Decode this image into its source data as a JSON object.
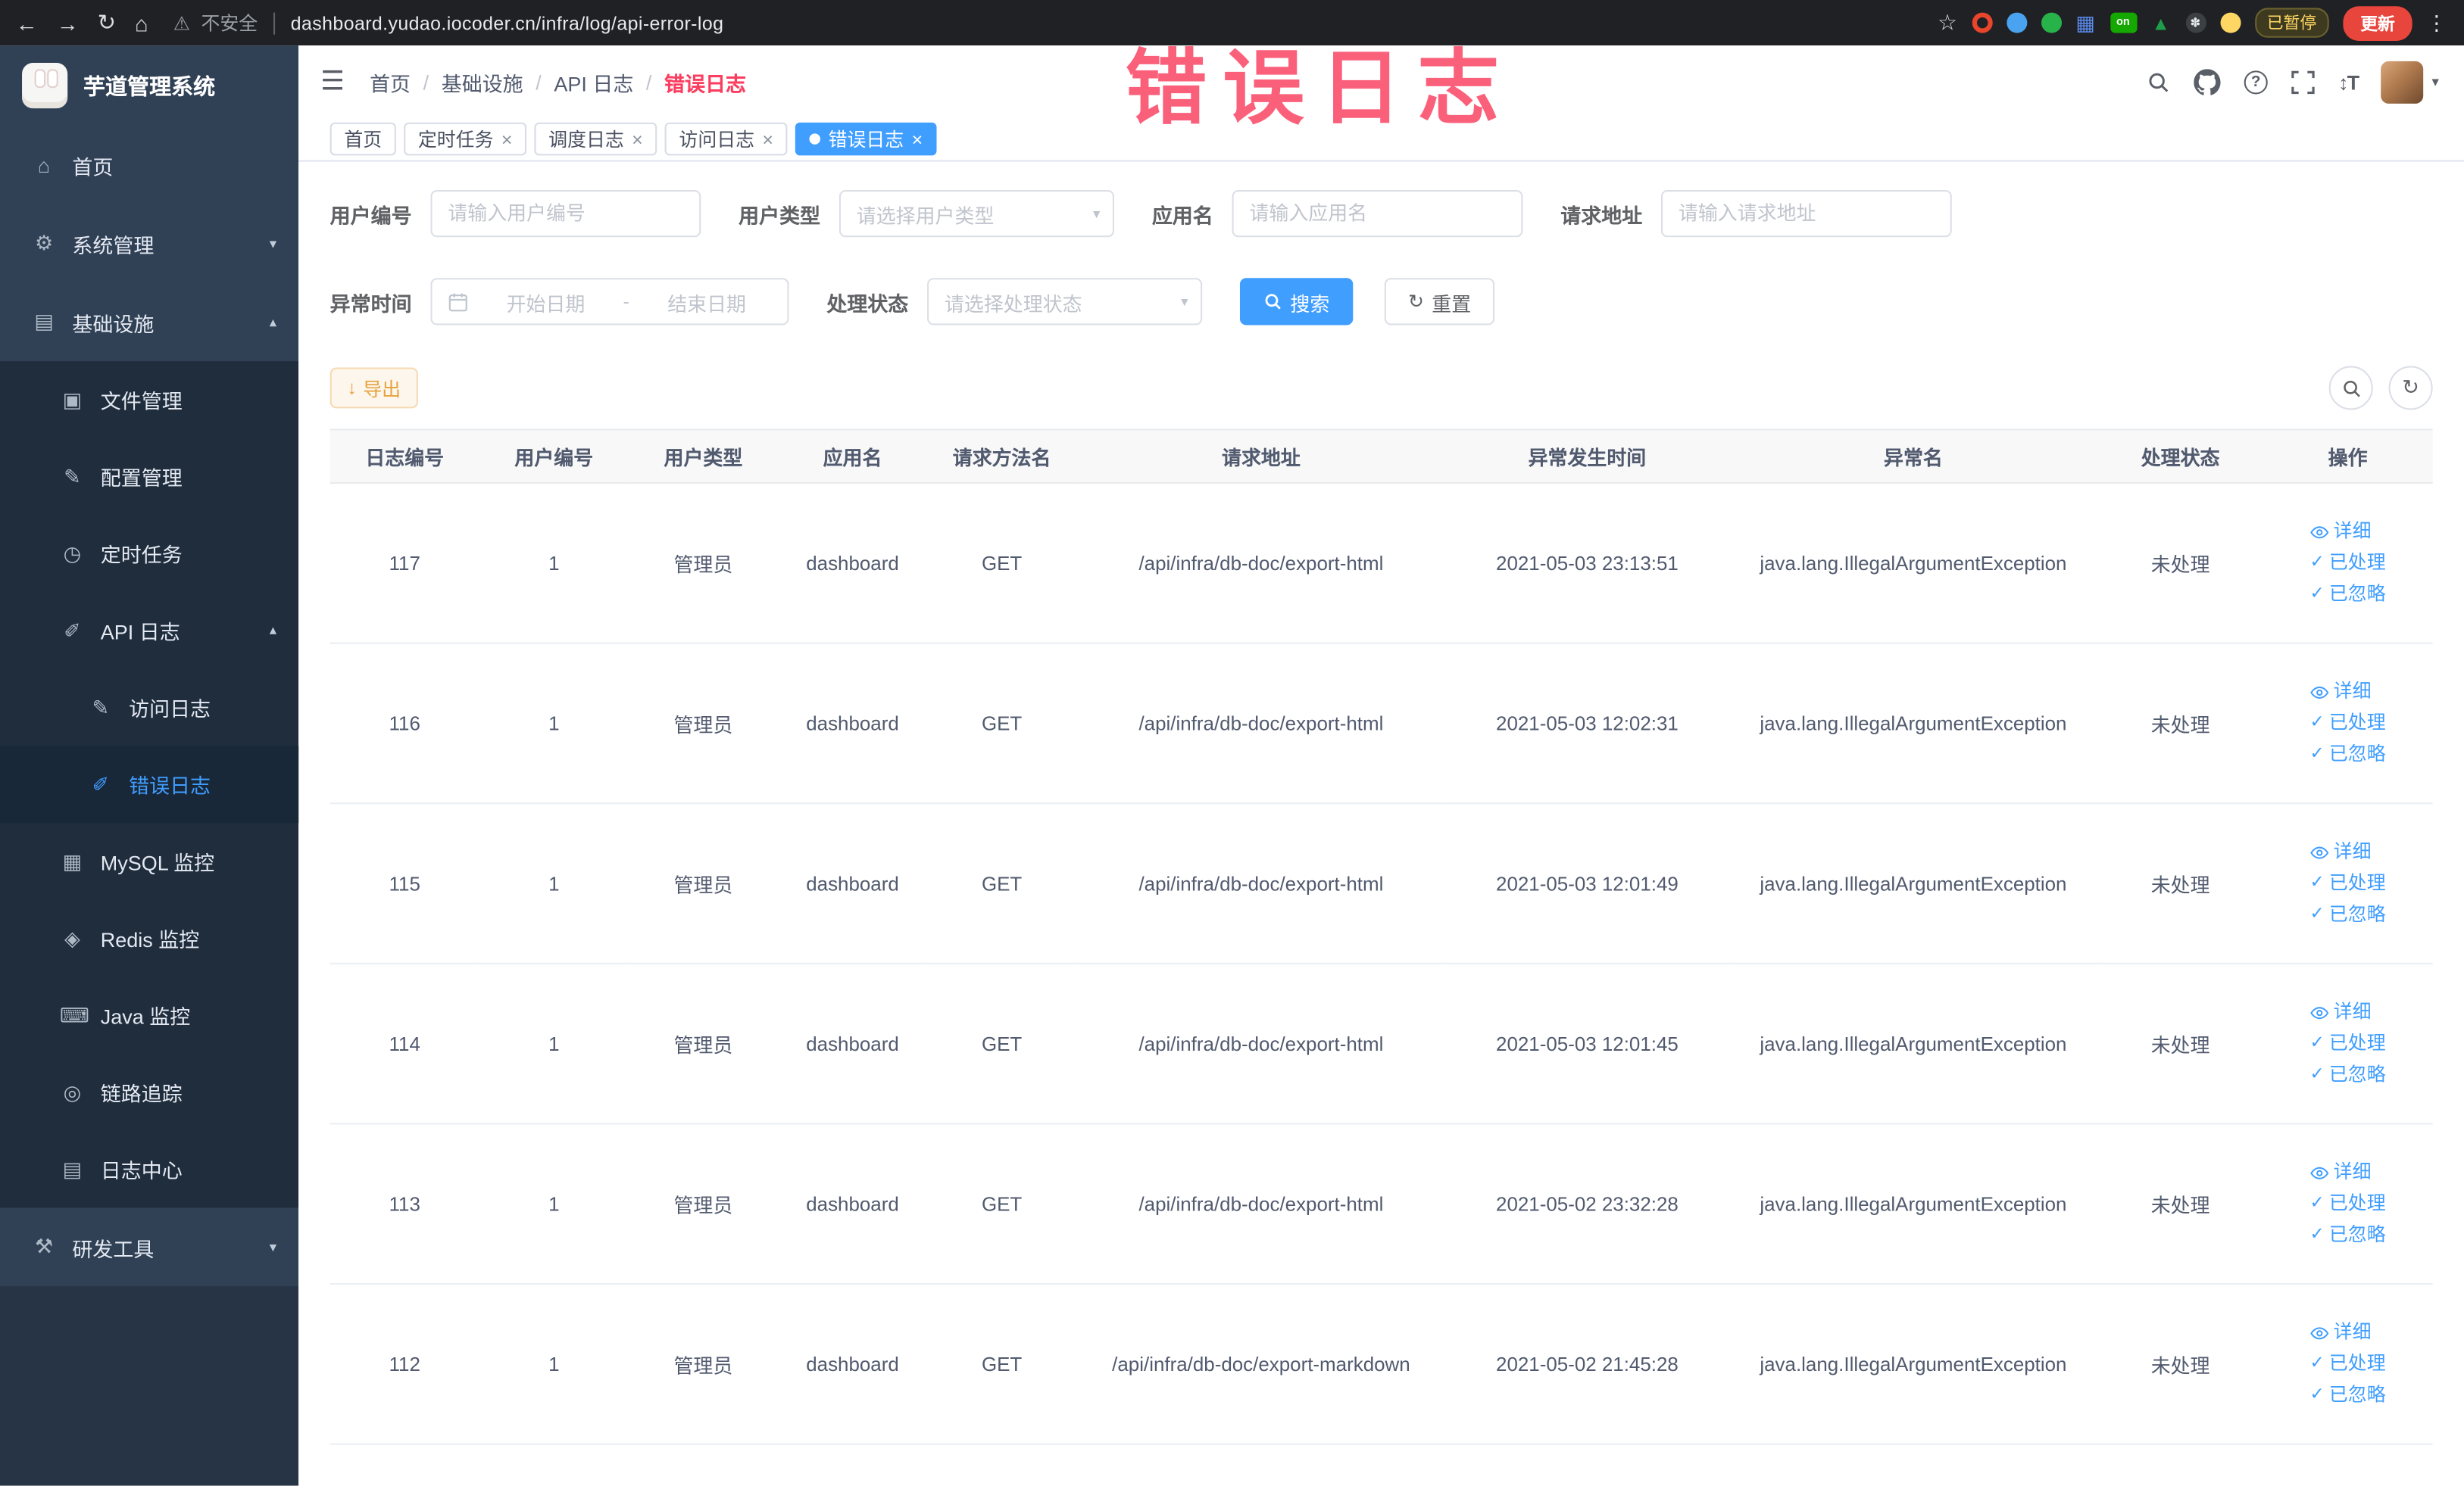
{
  "annotation": {
    "text": "错误日志",
    "color": "#fb3e5f"
  },
  "colors": {
    "accent": "#409EFF",
    "warning": "#e6a23c",
    "sidebar_bg": "#304156",
    "submenu_bg": "#1f2d3d"
  },
  "icons": {
    "back": "←",
    "forward": "→",
    "reload": "↻",
    "home": "⌂",
    "warning": "⚠",
    "star": "☆",
    "more": "⋮",
    "collapse": "☰",
    "slash": "/",
    "chevron_down": "▾",
    "chevron_up": "▴",
    "caret": "▾",
    "close": "×",
    "check": "✓",
    "download": "↓",
    "refresh": "↻",
    "question": "?",
    "text_size": "↕T",
    "grid": "▦",
    "tree": "▲",
    "paw": "✽",
    "on_label": "on"
  },
  "browser": {
    "security_label": "不安全",
    "url": "dashboard.yudao.iocoder.cn/infra/log/api-error-log",
    "paused_badge": "已暂停",
    "update_label": "更新"
  },
  "sidebar": {
    "logo_text": "芋道管理系统",
    "items": [
      {
        "label": "首页",
        "icon": "⌂"
      },
      {
        "label": "系统管理",
        "icon": "⚙"
      },
      {
        "label": "基础设施",
        "icon": "▤"
      },
      {
        "label": "文件管理",
        "icon": "▣"
      },
      {
        "label": "配置管理",
        "icon": "✎"
      },
      {
        "label": "定时任务",
        "icon": "◷"
      },
      {
        "label": "API 日志",
        "icon": "✐"
      },
      {
        "label": "访问日志",
        "icon": "✎"
      },
      {
        "label": "错误日志",
        "icon": "✐"
      },
      {
        "label": "MySQL 监控",
        "icon": "▦"
      },
      {
        "label": "Redis 监控",
        "icon": "◈"
      },
      {
        "label": "Java 监控",
        "icon": "⌨"
      },
      {
        "label": "链路追踪",
        "icon": "◎"
      },
      {
        "label": "日志中心",
        "icon": "▤"
      },
      {
        "label": "研发工具",
        "icon": "⚒"
      }
    ]
  },
  "header": {
    "breadcrumb": [
      "首页",
      "基础设施",
      "API 日志",
      "错误日志"
    ]
  },
  "tabs": [
    {
      "label": "首页"
    },
    {
      "label": "定时任务"
    },
    {
      "label": "调度日志"
    },
    {
      "label": "访问日志"
    },
    {
      "label": "错误日志"
    }
  ],
  "filters": {
    "user_id": {
      "label": "用户编号",
      "placeholder": "请输入用户编号"
    },
    "user_type": {
      "label": "用户类型",
      "placeholder": "请选择用户类型"
    },
    "app_name": {
      "label": "应用名",
      "placeholder": "请输入应用名"
    },
    "request_url": {
      "label": "请求地址",
      "placeholder": "请输入请求地址"
    },
    "exception_time": {
      "label": "异常时间",
      "start_placeholder": "开始日期",
      "separator": "-",
      "end_placeholder": "结束日期"
    },
    "process_status": {
      "label": "处理状态",
      "placeholder": "请选择处理状态"
    },
    "search_label": "搜索",
    "reset_label": "重置"
  },
  "toolbar": {
    "export_label": "导出"
  },
  "table": {
    "headers": [
      "日志编号",
      "用户编号",
      "用户类型",
      "应用名",
      "请求方法名",
      "请求地址",
      "异常发生时间",
      "异常名",
      "处理状态",
      "操作"
    ],
    "actions": {
      "detail": "详细",
      "processed": "已处理",
      "ignored": "已忽略"
    },
    "rows": [
      {
        "id": "117",
        "user_id": "1",
        "user_type": "管理员",
        "app": "dashboard",
        "method": "GET",
        "url": "/api/infra/db-doc/export-html",
        "time": "2021-05-03 23:13:51",
        "exception": "java.lang.IllegalArgumentException",
        "status": "未处理"
      },
      {
        "id": "116",
        "user_id": "1",
        "user_type": "管理员",
        "app": "dashboard",
        "method": "GET",
        "url": "/api/infra/db-doc/export-html",
        "time": "2021-05-03 12:02:31",
        "exception": "java.lang.IllegalArgumentException",
        "status": "未处理"
      },
      {
        "id": "115",
        "user_id": "1",
        "user_type": "管理员",
        "app": "dashboard",
        "method": "GET",
        "url": "/api/infra/db-doc/export-html",
        "time": "2021-05-03 12:01:49",
        "exception": "java.lang.IllegalArgumentException",
        "status": "未处理"
      },
      {
        "id": "114",
        "user_id": "1",
        "user_type": "管理员",
        "app": "dashboard",
        "method": "GET",
        "url": "/api/infra/db-doc/export-html",
        "time": "2021-05-03 12:01:45",
        "exception": "java.lang.IllegalArgumentException",
        "status": "未处理"
      },
      {
        "id": "113",
        "user_id": "1",
        "user_type": "管理员",
        "app": "dashboard",
        "method": "GET",
        "url": "/api/infra/db-doc/export-html",
        "time": "2021-05-02 23:32:28",
        "exception": "java.lang.IllegalArgumentException",
        "status": "未处理"
      },
      {
        "id": "112",
        "user_id": "1",
        "user_type": "管理员",
        "app": "dashboard",
        "method": "GET",
        "url": "/api/infra/db-doc/export-markdown",
        "time": "2021-05-02 21:45:28",
        "exception": "java.lang.IllegalArgumentException",
        "status": "未处理"
      }
    ]
  }
}
